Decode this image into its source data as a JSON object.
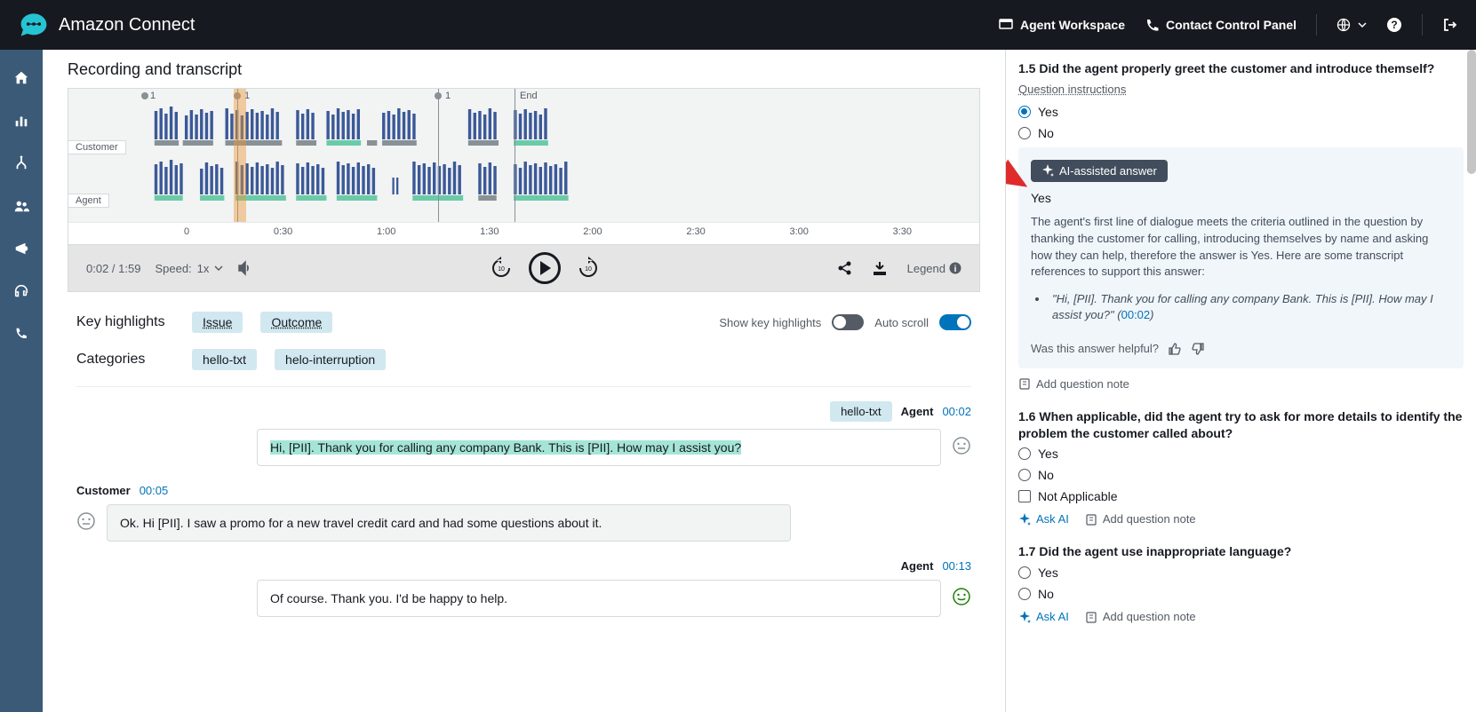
{
  "header": {
    "product": "Amazon Connect",
    "agent_workspace": "Agent Workspace",
    "contact_panel": "Contact Control Panel"
  },
  "recording": {
    "title": "Recording and transcript",
    "customer_label": "Customer",
    "agent_label": "Agent",
    "end_label": "End",
    "markers": [
      "1",
      "1",
      "1"
    ],
    "time_axis": [
      "0",
      "0:30",
      "1:00",
      "1:30",
      "2:00",
      "2:30",
      "3:00",
      "3:30"
    ]
  },
  "player": {
    "time_display": "0:02 / 1:59",
    "speed_label": "Speed:",
    "speed_value": "1x",
    "legend": "Legend"
  },
  "highlights": {
    "key_label": "Key highlights",
    "issue": "Issue",
    "outcome": "Outcome",
    "categories_label": "Categories",
    "cat1": "hello-txt",
    "cat2": "helo-interruption",
    "show_label": "Show key highlights",
    "auto_scroll_label": "Auto scroll"
  },
  "transcript": [
    {
      "side": "agent",
      "tag": "hello-txt",
      "who": "Agent",
      "ts": "00:02",
      "text": "Hi, [PII]. Thank you for calling any company Bank. This is [PII]. How may I assist you?",
      "highlighted": true,
      "sentiment": "neutral"
    },
    {
      "side": "customer",
      "who": "Customer",
      "ts": "00:05",
      "text": "Ok. Hi [PII]. I saw a promo for a new travel credit card and had some questions about it.",
      "grey": true,
      "sentiment": "neutral"
    },
    {
      "side": "agent",
      "who": "Agent",
      "ts": "00:13",
      "text": "Of course. Thank you. I'd be happy to help.",
      "sentiment": "positive"
    }
  ],
  "eval": {
    "q15": {
      "title": "1.5 Did the agent properly greet the customer and introduce themself?",
      "instructions": "Question instructions",
      "yes": "Yes",
      "no": "No",
      "ai_badge": "AI-assisted answer",
      "ai_answer": "Yes",
      "ai_explanation": "The agent's first line of dialogue meets the criteria outlined in the question by thanking the customer for calling, introducing themselves by name and asking how they can help, therefore the answer is Yes. Here are some transcript references to support this answer:",
      "ai_quote": "\"Hi, [PII]. Thank you for calling any company Bank. This is [PII]. How may I assist you?\"",
      "ai_quote_ts": "00:02",
      "feedback_label": "Was this answer helpful?",
      "add_note": "Add question note"
    },
    "q16": {
      "title": "1.6 When applicable, did the agent try to ask for more details to identify the problem the customer called about?",
      "yes": "Yes",
      "no": "No",
      "na": "Not Applicable",
      "ask_ai": "Ask AI",
      "add_note": "Add question note"
    },
    "q17": {
      "title": "1.7 Did the agent use inappropriate language?",
      "yes": "Yes",
      "no": "No",
      "ask_ai": "Ask AI",
      "add_note": "Add question note"
    }
  }
}
